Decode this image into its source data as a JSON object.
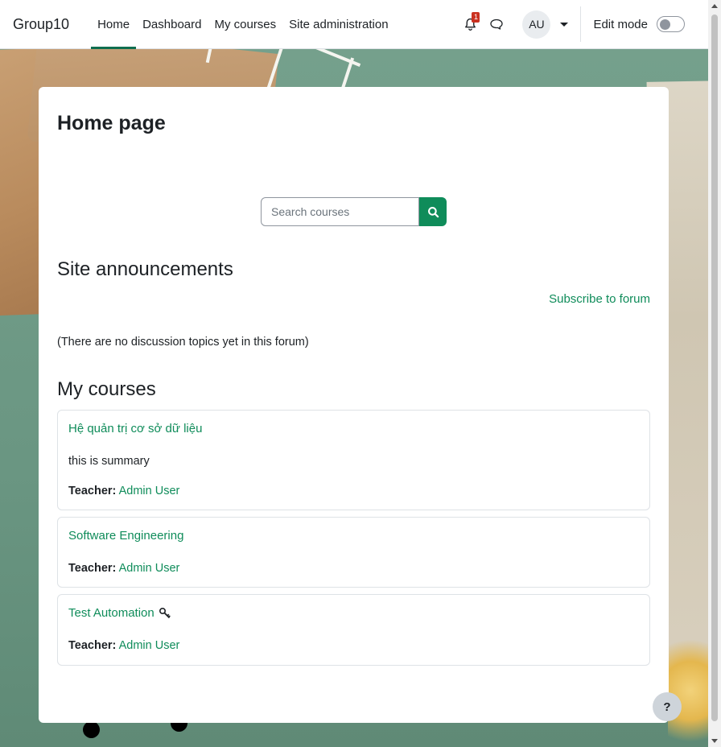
{
  "navbar": {
    "brand": "Group10",
    "items": [
      {
        "label": "Home",
        "active": true
      },
      {
        "label": "Dashboard",
        "active": false
      },
      {
        "label": "My courses",
        "active": false
      },
      {
        "label": "Site administration",
        "active": false
      }
    ],
    "notification_count": "1",
    "notification_icon": "bell-icon",
    "message_icon": "chat-bubble-icon",
    "user_initials": "AU",
    "edit_mode_label": "Edit mode",
    "edit_mode_on": false
  },
  "main": {
    "page_title": "Home page",
    "search": {
      "placeholder": "Search courses",
      "value": "",
      "icon": "search-icon"
    },
    "announcements": {
      "title": "Site announcements",
      "subscribe_label": "Subscribe to forum",
      "empty_message": "(There are no discussion topics yet in this forum)"
    },
    "my_courses": {
      "title": "My courses",
      "courses": [
        {
          "name": "Hệ quản trị cơ sở dữ liệu",
          "summary": "this is summary",
          "teacher_label": "Teacher:",
          "teacher": "Admin User",
          "guest_key": false
        },
        {
          "name": "Software Engineering",
          "summary": "",
          "teacher_label": "Teacher:",
          "teacher": "Admin User",
          "guest_key": false
        },
        {
          "name": "Test Automation",
          "summary": "",
          "teacher_label": "Teacher:",
          "teacher": "Admin User",
          "guest_key": true
        }
      ]
    }
  },
  "help": {
    "label": "?"
  },
  "colors": {
    "accent": "#0f8c5a",
    "badge": "#ca3120",
    "text": "#1d2125"
  }
}
